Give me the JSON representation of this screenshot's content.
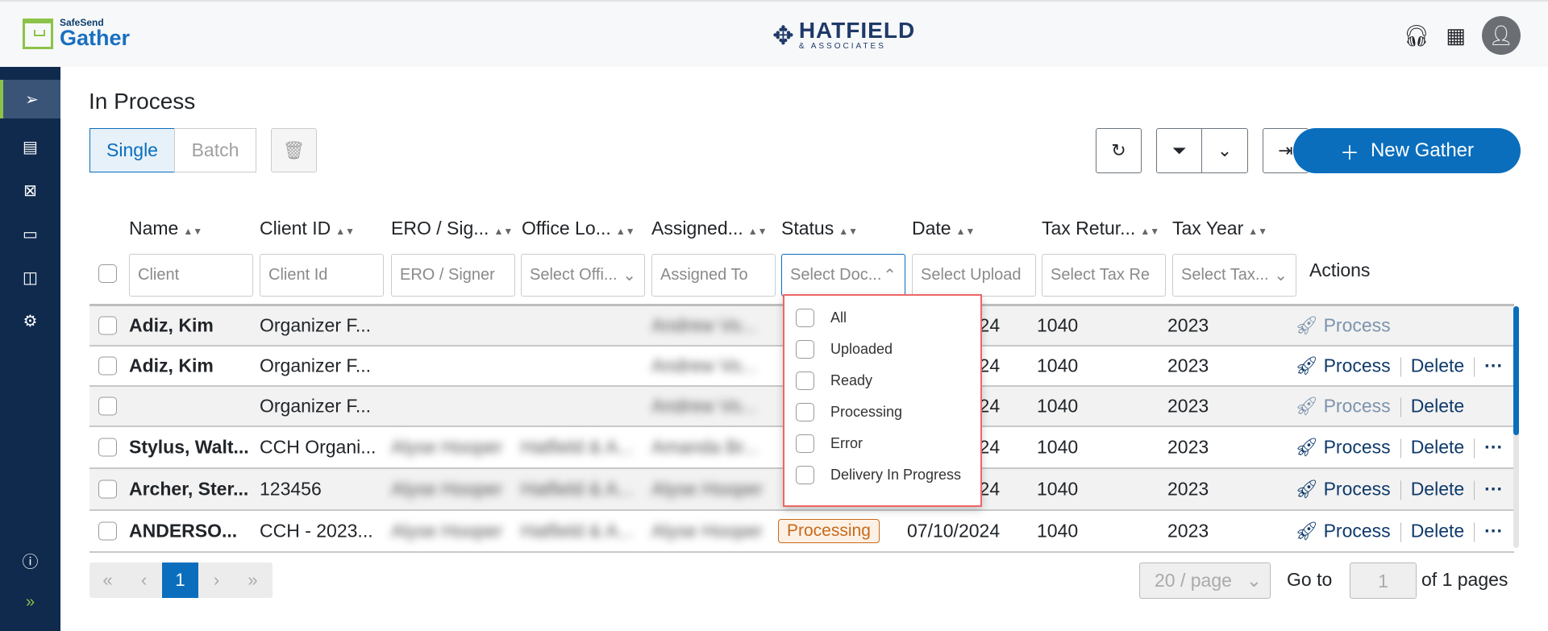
{
  "header": {
    "logo_small": "SafeSend",
    "logo_big": "Gather",
    "brand_name": "HATFIELD",
    "brand_sub": "& ASSOCIATES"
  },
  "page": {
    "title": "In Process"
  },
  "toolbar": {
    "single": "Single",
    "batch": "Batch",
    "new_gather": "New Gather"
  },
  "columns": [
    "Name",
    "Client ID",
    "ERO / Sig...",
    "Office Lo...",
    "Assigned...",
    "Status",
    "Date",
    "Tax Retur...",
    "Tax Year"
  ],
  "actions_header": "Actions",
  "filters": {
    "client": "Client",
    "client_id": "Client Id",
    "ero": "ERO / Signer",
    "office": "Select Offi...",
    "assigned": "Assigned To",
    "status": "Select Doc...",
    "date": "Select Upload",
    "tax_return": "Select Tax Re",
    "tax_year": "Select Tax..."
  },
  "status_options": [
    "All",
    "Uploaded",
    "Ready",
    "Processing",
    "Error",
    "Delivery In Progress"
  ],
  "rows": [
    {
      "name": "Adiz, Kim",
      "client_id": "Organizer F...",
      "ero": "",
      "office": "",
      "assigned": "Andrew Vo...",
      "status": "",
      "date": "07/10/2024",
      "tax_return": "1040",
      "tax_year": "2023",
      "process": "Process",
      "process_enabled": false,
      "delete": "",
      "more": false
    },
    {
      "name": "Adiz, Kim",
      "client_id": "Organizer F...",
      "ero": "",
      "office": "",
      "assigned": "Andrew Vo...",
      "status": "",
      "date": "07/10/2024",
      "tax_return": "1040",
      "tax_year": "2023",
      "process": "Process",
      "process_enabled": true,
      "delete": "Delete",
      "more": true
    },
    {
      "name": "",
      "client_id": "Organizer F...",
      "ero": "",
      "office": "",
      "assigned": "Andrew Vo...",
      "status": "",
      "date": "07/10/2024",
      "tax_return": "1040",
      "tax_year": "2023",
      "process": "Process",
      "process_enabled": false,
      "delete": "Delete",
      "more": false
    },
    {
      "name": "Stylus, Walt...",
      "client_id": "CCH Organi...",
      "ero": "Alyse Hooper",
      "office": "Hatfield & A...",
      "assigned": "Amanda Br...",
      "status": "",
      "date": "07/10/2024",
      "tax_return": "1040",
      "tax_year": "2023",
      "process": "Process",
      "process_enabled": true,
      "delete": "Delete",
      "more": true
    },
    {
      "name": "Archer, Ster...",
      "client_id": "123456",
      "ero": "Alyse Hooper",
      "office": "Hatfield & A...",
      "assigned": "Alyse Hooper",
      "status": "",
      "date": "07/10/2024",
      "tax_return": "1040",
      "tax_year": "2023",
      "process": "Process",
      "process_enabled": true,
      "delete": "Delete",
      "more": true
    },
    {
      "name": "ANDERSO...",
      "client_id": "CCH - 2023...",
      "ero": "Alyse Hooper",
      "office": "Hatfield & A...",
      "assigned": "Alyse Hooper",
      "status": "Processing",
      "date": "07/10/2024",
      "tax_return": "1040",
      "tax_year": "2023",
      "process": "Process",
      "process_enabled": true,
      "delete": "Delete",
      "more": true
    }
  ],
  "pagination": {
    "current": "1",
    "per_page": "20 / page",
    "goto_label": "Go to",
    "goto_value": "1",
    "of_pages": "of 1  pages"
  },
  "colors": {
    "primary": "#0a6ebd",
    "sidebar": "#0f2a4d",
    "accent": "#8bc34a",
    "badge": "#c86a1a",
    "dropdown_outline": "#e66666"
  }
}
